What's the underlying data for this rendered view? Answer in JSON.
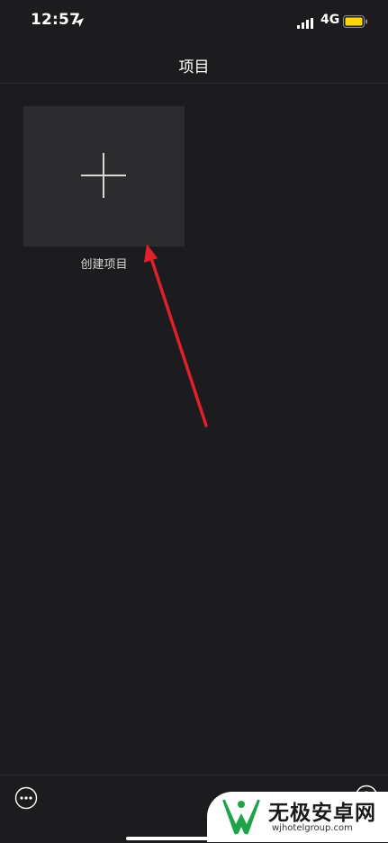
{
  "status_bar": {
    "time": "12:57",
    "network": "4G",
    "icons": [
      "location-arrow-icon",
      "signal-icon",
      "battery-icon"
    ],
    "battery_color": "#ffd60a"
  },
  "nav": {
    "title": "项目"
  },
  "main": {
    "create_project": {
      "label": "创建项目",
      "icon": "plus-icon"
    }
  },
  "annotation": {
    "arrow_color": "#e0202a"
  },
  "bottom_bar": {
    "icons": [
      "more-icon",
      "help-icon"
    ]
  },
  "watermark": {
    "title": "无极安卓网",
    "url": "wjhotelgroup.com",
    "logo_color": "#1fa34a"
  }
}
